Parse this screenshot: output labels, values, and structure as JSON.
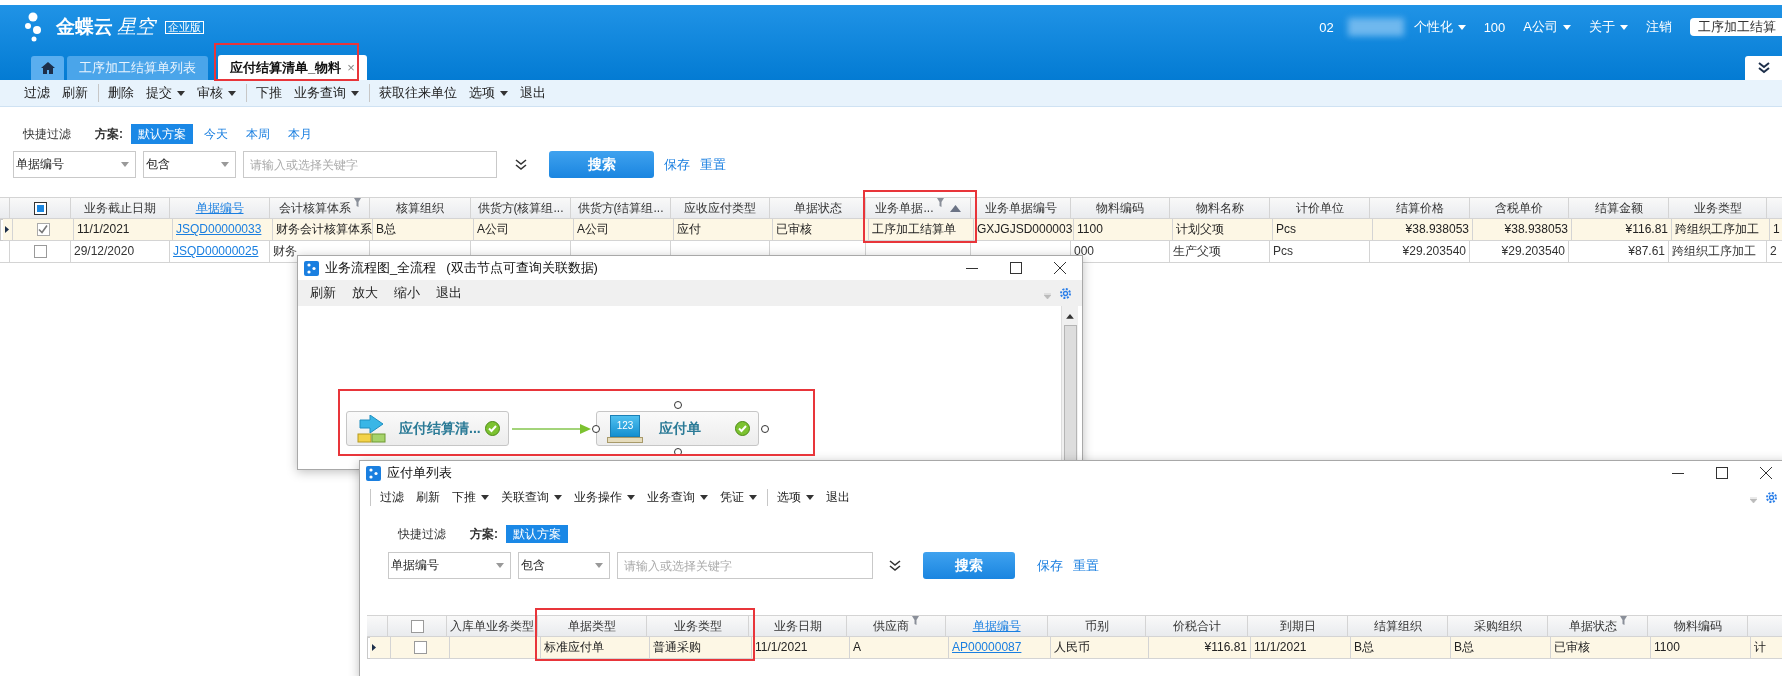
{
  "header": {
    "brand": "金蝶云",
    "product": "星空",
    "edition": "企业版",
    "user_code": "02",
    "menus": [
      {
        "label": "个性化",
        "dropdown": true
      },
      {
        "label": "100"
      },
      {
        "label": "A公司",
        "dropdown": true
      },
      {
        "label": "关于",
        "dropdown": true
      },
      {
        "label": "注销"
      }
    ],
    "context_button": "工序加工结算"
  },
  "tabs": [
    {
      "kind": "home",
      "selected": false
    },
    {
      "kind": "page",
      "label": "工序加工结算单列表",
      "selected": false
    },
    {
      "kind": "page",
      "label": "应付结算清单_物料",
      "selected": true,
      "close": "×",
      "highlighted": true
    }
  ],
  "toolbar": [
    {
      "label": "过滤"
    },
    {
      "label": "刷新"
    },
    {
      "label": "删除",
      "separator_before": true
    },
    {
      "label": "提交",
      "dropdown": true
    },
    {
      "label": "审核",
      "dropdown": true
    },
    {
      "label": "下推",
      "separator_before": true
    },
    {
      "label": "业务查询",
      "dropdown": true
    },
    {
      "label": "获取往来单位",
      "separator_before": true
    },
    {
      "label": "选项",
      "dropdown": true
    },
    {
      "label": "退出"
    }
  ],
  "filter": {
    "quick_filter": "快捷过滤",
    "scheme_label": "方案:",
    "schemes": [
      {
        "label": "默认方案",
        "selected": true
      },
      {
        "label": "今天",
        "selected": false
      },
      {
        "label": "本周",
        "selected": false
      },
      {
        "label": "本月",
        "selected": false
      }
    ],
    "field": "单据编号",
    "operator": "包含",
    "keyword_placeholder": "请输入或选择关键字",
    "search": "搜索",
    "actions": [
      "保存",
      "重置"
    ]
  },
  "table": {
    "select_all": {
      "checked": false,
      "indeterminate": true
    },
    "columns": [
      {
        "label": "业务截止日期"
      },
      {
        "label": "单据编号",
        "link": true
      },
      {
        "label": "会计核算体系",
        "filter": true
      },
      {
        "label": "核算组织"
      },
      {
        "label": "供货方(核算组..."
      },
      {
        "label": "供货方(结算组..."
      },
      {
        "label": "应收应付类型"
      },
      {
        "label": "单据状态"
      },
      {
        "label": "业务单据...",
        "filter": true,
        "sorted_ascending": true,
        "highlighted": true
      },
      {
        "label": "业务单据编号"
      },
      {
        "label": "物料编码"
      },
      {
        "label": "物料名称"
      },
      {
        "label": "计价单位"
      },
      {
        "label": "结算价格",
        "numeric": true
      },
      {
        "label": "含税单价",
        "numeric": true
      },
      {
        "label": "结算金额",
        "numeric": true
      },
      {
        "label": "业务类型"
      },
      {}
    ],
    "rows": [
      {
        "selected": true,
        "checked": true,
        "cells": [
          "11/1/2021",
          "JSQD00000033",
          "财务会计核算体系",
          "B总",
          "A公司",
          "A公司",
          "应付",
          "已审核",
          "工序加工结算单",
          "GXJGJSD000003",
          "1100",
          "计划父项",
          "Pcs",
          "¥38.938053",
          "¥38.938053",
          "¥116.81",
          "跨组织工序加工",
          "1"
        ]
      },
      {
        "selected": false,
        "checked": false,
        "cells": [
          "29/12/2020",
          "JSQD00000025",
          "财务",
          null,
          null,
          null,
          null,
          null,
          null,
          null,
          "000",
          "生产父项",
          "Pcs",
          "¥29.203540",
          "¥29.203540",
          "¥87.61",
          "跨组织工序加工",
          "2"
        ]
      }
    ]
  },
  "flow_window": {
    "title": "业务流程图_全流程",
    "hint": "(双击节点可查询关联数据)",
    "toolbar": [
      "刷新",
      "放大",
      "缩小",
      "退出"
    ],
    "highlighted": true,
    "nodes": [
      {
        "kind": "settlement",
        "label": "应付结算清...",
        "done": true,
        "selected": false
      },
      {
        "kind": "payable",
        "label": "应付单",
        "icon_text": "123",
        "done": true,
        "selected": true
      }
    ]
  },
  "list_window": {
    "title": "应付单列表",
    "toolbar": [
      {
        "label": "过滤",
        "separator_before": true
      },
      {
        "label": "刷新"
      },
      {
        "label": "下推",
        "dropdown": true
      },
      {
        "label": "关联查询",
        "dropdown": true
      },
      {
        "label": "业务操作",
        "dropdown": true
      },
      {
        "label": "业务查询",
        "dropdown": true
      },
      {
        "label": "凭证",
        "dropdown": true
      },
      {
        "label": "选项",
        "dropdown": true,
        "separator_before": true
      },
      {
        "label": "退出"
      }
    ],
    "filter": {
      "quick_filter": "快捷过滤",
      "scheme_label": "方案:",
      "schemes": [
        {
          "label": "默认方案",
          "selected": true
        }
      ],
      "field": "单据编号",
      "operator": "包含",
      "keyword_placeholder": "请输入或选择关键字",
      "search": "搜索",
      "actions": [
        "保存",
        "重置"
      ]
    },
    "table": {
      "select_all": {
        "checked": false,
        "indeterminate": false
      },
      "columns": [
        {
          "label": "入库单业务类型"
        },
        {
          "label": "单据类型",
          "highlighted": true
        },
        {
          "label": "业务类型",
          "highlighted": true
        },
        {
          "label": "业务日期"
        },
        {
          "label": "供应商",
          "filter": true
        },
        {
          "label": "单据编号",
          "link": true
        },
        {
          "label": "币别"
        },
        {
          "label": "价税合计",
          "numeric": true
        },
        {
          "label": "到期日"
        },
        {
          "label": "结算组织"
        },
        {
          "label": "采购组织"
        },
        {
          "label": "单据状态",
          "filter": true
        },
        {
          "label": "物料编码"
        },
        {}
      ],
      "rows": [
        {
          "selected": true,
          "checked": false,
          "cells": [
            null,
            "标准应付单",
            "普通采购",
            "11/1/2021",
            "A",
            "AP00000087",
            "人民币",
            "¥116.81",
            "11/1/2021",
            "B总",
            "B总",
            "已审核",
            "1100",
            "计"
          ]
        }
      ]
    }
  }
}
